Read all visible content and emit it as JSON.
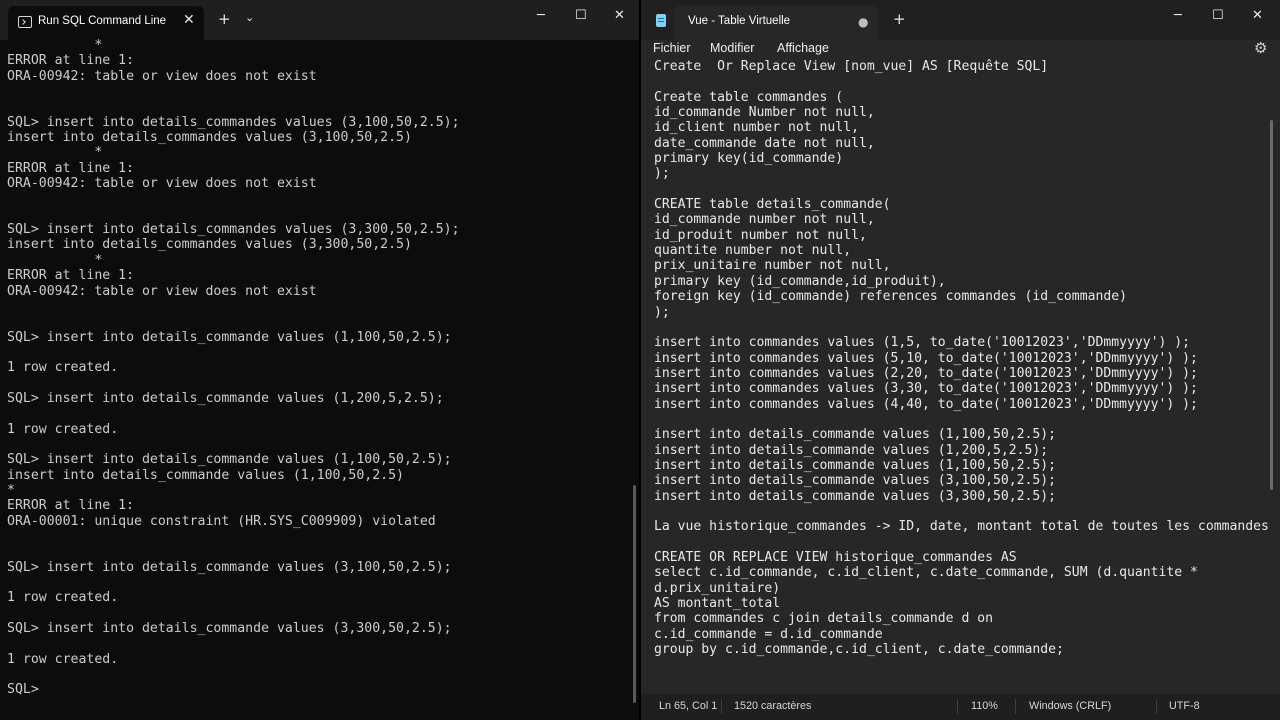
{
  "terminal": {
    "tab_title": "Run SQL Command Line",
    "icons": {
      "tab": "terminal-icon",
      "close": "close-icon",
      "new_tab": "plus-icon",
      "dropdown": "chevron-down-icon"
    },
    "window_controls": {
      "minimize": "─",
      "maximize": "☐",
      "close": "✕"
    },
    "lines": [
      "           *",
      "ERROR at line 1:",
      "ORA-00942: table or view does not exist",
      "",
      "",
      "SQL> insert into details_commandes values (3,100,50,2.5);",
      "insert into details_commandes values (3,100,50,2.5)",
      "           *",
      "ERROR at line 1:",
      "ORA-00942: table or view does not exist",
      "",
      "",
      "SQL> insert into details_commandes values (3,300,50,2.5);",
      "insert into details_commandes values (3,300,50,2.5)",
      "           *",
      "ERROR at line 1:",
      "ORA-00942: table or view does not exist",
      "",
      "",
      "SQL> insert into details_commande values (1,100,50,2.5);",
      "",
      "1 row created.",
      "",
      "SQL> insert into details_commande values (1,200,5,2.5);",
      "",
      "1 row created.",
      "",
      "SQL> insert into details_commande values (1,100,50,2.5);",
      "insert into details_commande values (1,100,50,2.5)",
      "*",
      "ERROR at line 1:",
      "ORA-00001: unique constraint (HR.SYS_C009909) violated",
      "",
      "",
      "SQL> insert into details_commande values (3,100,50,2.5);",
      "",
      "1 row created.",
      "",
      "SQL> insert into details_commande values (3,300,50,2.5);",
      "",
      "1 row created.",
      "",
      "SQL>"
    ]
  },
  "notepad": {
    "tab_title": "Vue - Table Virtuelle",
    "unsaved_indicator": "●",
    "icons": {
      "app": "notepad-icon",
      "new_tab": "plus-icon",
      "settings": "gear-icon"
    },
    "window_controls": {
      "minimize": "─",
      "maximize": "☐",
      "close": "✕"
    },
    "menu": {
      "file": "Fichier",
      "edit": "Modifier",
      "view": "Affichage"
    },
    "lines": [
      "Create  Or Replace View [nom_vue] AS [Requête SQL]",
      "",
      "Create table commandes (",
      "id_commande Number not null,",
      "id_client number not null,",
      "date_commande date not null,",
      "primary key(id_commande)",
      ");",
      "",
      "CREATE table details_commande(",
      "id_commande number not null,",
      "id_produit number not null,",
      "quantite number not null,",
      "prix_unitaire number not null,",
      "primary key (id_commande,id_produit),",
      "foreign key (id_commande) references commandes (id_commande)",
      ");",
      "",
      "insert into commandes values (1,5, to_date('10012023','DDmmyyyy') );",
      "insert into commandes values (5,10, to_date('10012023','DDmmyyyy') );",
      "insert into commandes values (2,20, to_date('10012023','DDmmyyyy') );",
      "insert into commandes values (3,30, to_date('10012023','DDmmyyyy') );",
      "insert into commandes values (4,40, to_date('10012023','DDmmyyyy') );",
      "",
      "insert into details_commande values (1,100,50,2.5);",
      "insert into details_commande values (1,200,5,2.5);",
      "insert into details_commande values (1,100,50,2.5);",
      "insert into details_commande values (3,100,50,2.5);",
      "insert into details_commande values (3,300,50,2.5);",
      "",
      "La vue historique_commandes -> ID, date, montant total de toutes les commandes",
      "",
      "CREATE OR REPLACE VIEW historique_commandes AS",
      "select c.id_commande, c.id_client, c.date_commande, SUM (d.quantite *",
      "d.prix_unitaire)",
      "AS montant_total",
      "from commandes c join details_commande d on",
      "c.id_commande = d.id_commande",
      "group by c.id_commande,c.id_client, c.date_commande;"
    ],
    "status": {
      "position": "Ln 65, Col 1",
      "chars": "1520 caractères",
      "zoom": "110%",
      "line_ending": "Windows (CRLF)",
      "encoding": "UTF-8"
    }
  }
}
